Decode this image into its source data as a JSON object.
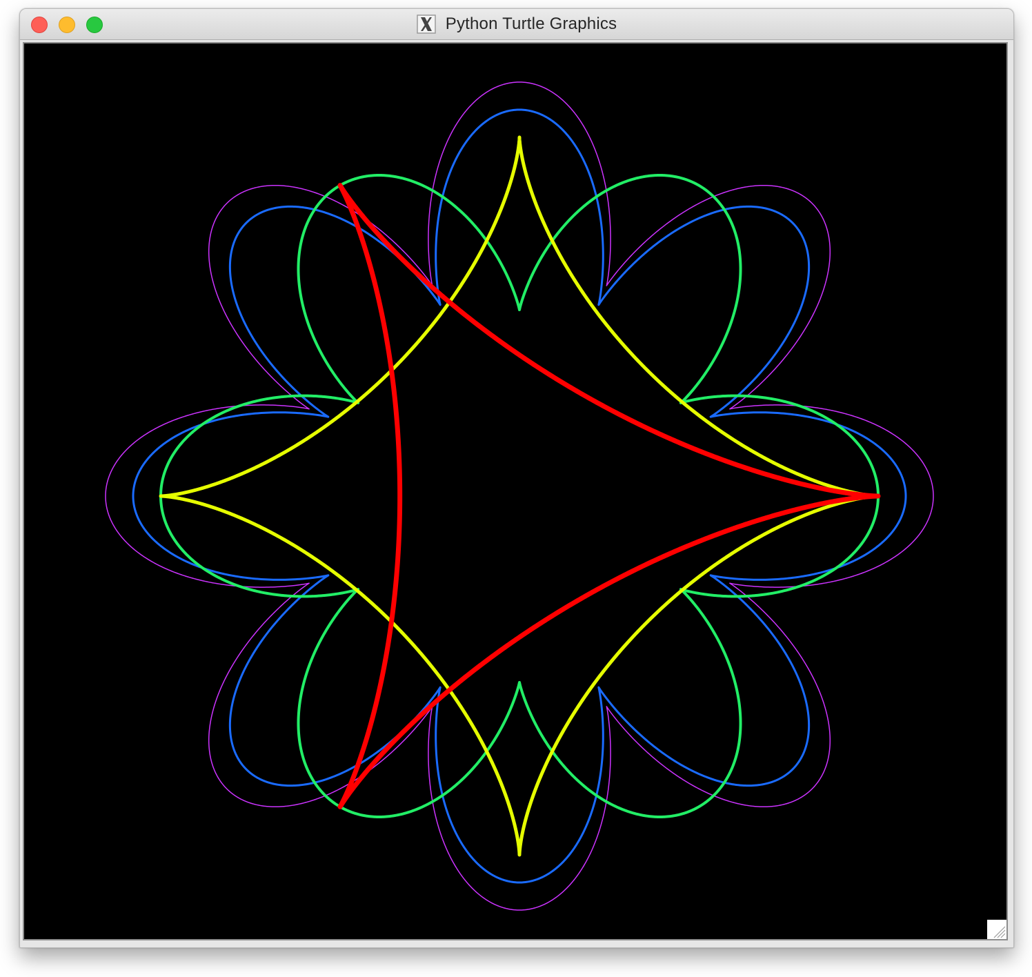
{
  "window": {
    "title": "Python Turtle Graphics",
    "app_icon": "x11-icon"
  },
  "window_controls": {
    "close": "close-icon",
    "minimize": "minimize-icon",
    "zoom": "zoom-icon"
  },
  "canvas": {
    "background": "#000000",
    "curves": [
      {
        "name": "magenta",
        "color": "#cc33ff",
        "lobes": 8,
        "stroke": 1.5
      },
      {
        "name": "blue",
        "color": "#1a6bff",
        "lobes": 8,
        "stroke": 3
      },
      {
        "name": "green",
        "color": "#22ee66",
        "lobes": 6,
        "stroke": 4
      },
      {
        "name": "yellow",
        "color": "#e6ff00",
        "lobes": 4,
        "stroke": 5
      },
      {
        "name": "red",
        "color": "#ff0000",
        "lobes": 3,
        "stroke": 7
      }
    ]
  }
}
